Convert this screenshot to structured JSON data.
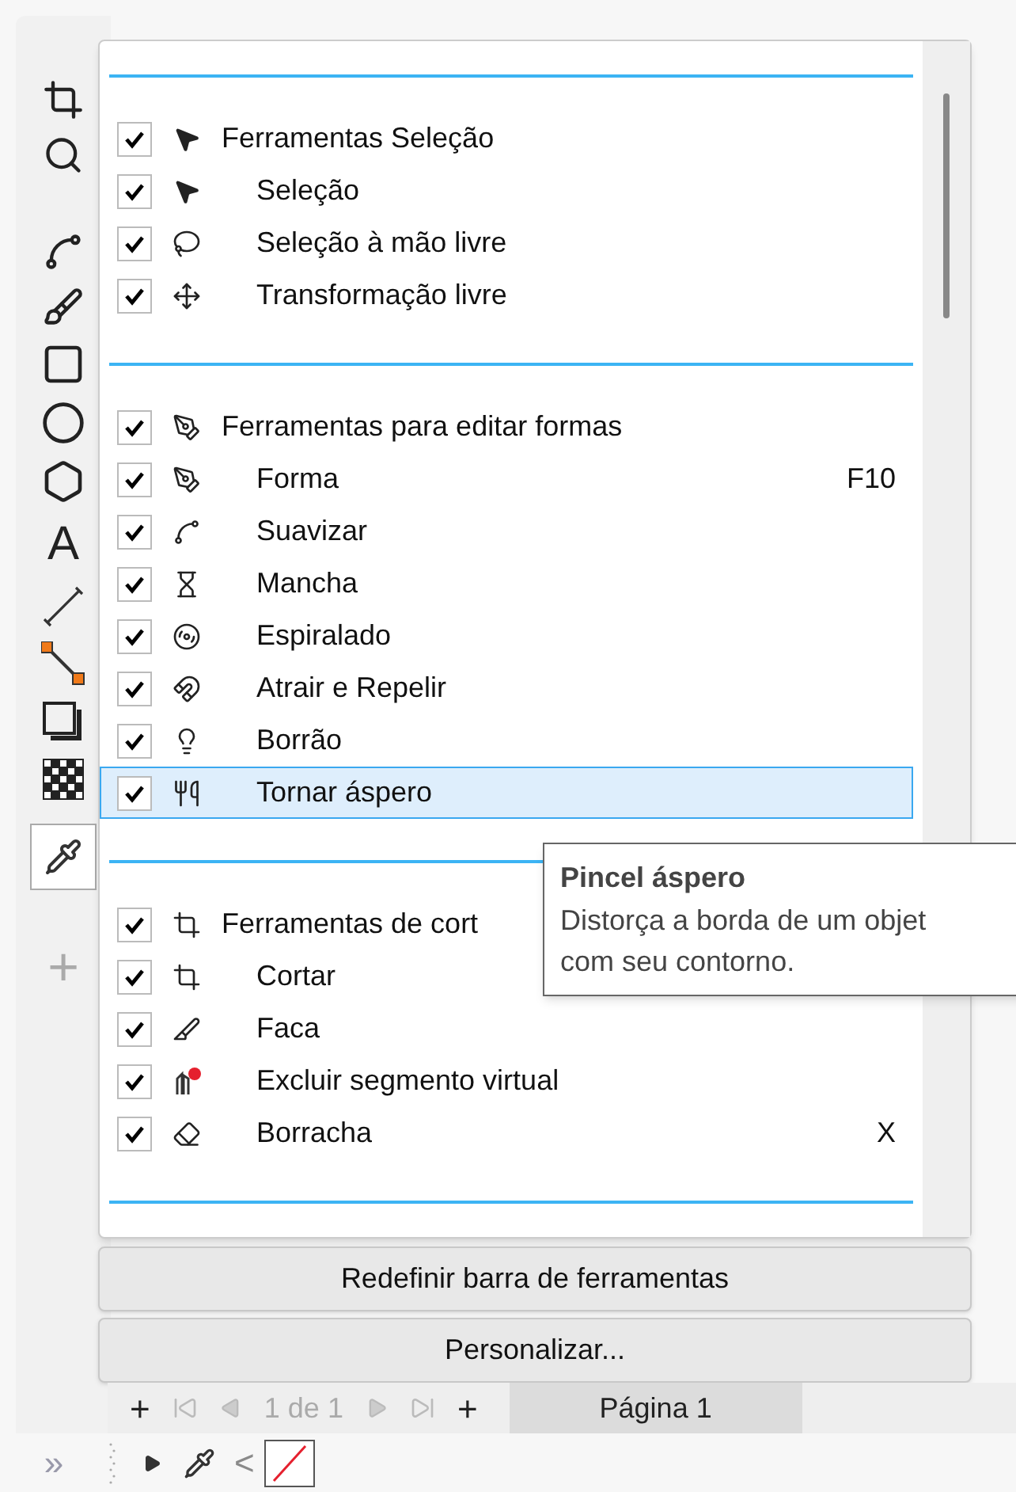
{
  "toolbox": {
    "text_tool": "A",
    "add_button": "+",
    "more_button": "»"
  },
  "menu": {
    "groups": [
      {
        "rows": [
          {
            "kind": "header",
            "label": "Ferramentas Seleção",
            "checked": true,
            "selected": false
          },
          {
            "kind": "tool",
            "label": "Seleção",
            "checked": true,
            "selected": false
          },
          {
            "kind": "tool",
            "label": "Seleção à mão livre",
            "checked": true,
            "selected": false
          },
          {
            "kind": "tool",
            "label": "Transformação livre",
            "checked": true,
            "selected": false
          }
        ]
      },
      {
        "rows": [
          {
            "kind": "header",
            "label": "Ferramentas para editar formas",
            "checked": true,
            "selected": false
          },
          {
            "kind": "tool",
            "label": "Forma",
            "shortcut": "F10",
            "checked": true,
            "selected": false
          },
          {
            "kind": "tool",
            "label": "Suavizar",
            "checked": true,
            "selected": false
          },
          {
            "kind": "tool",
            "label": "Mancha",
            "checked": true,
            "selected": false
          },
          {
            "kind": "tool",
            "label": "Espiralado",
            "checked": true,
            "selected": false
          },
          {
            "kind": "tool",
            "label": "Atrair e Repelir",
            "checked": true,
            "selected": false
          },
          {
            "kind": "tool",
            "label": "Borrão",
            "checked": true,
            "selected": false
          },
          {
            "kind": "tool",
            "label": "Tornar áspero",
            "checked": true,
            "selected": true
          }
        ]
      },
      {
        "rows": [
          {
            "kind": "header",
            "label": "Ferramentas de cort",
            "checked": true,
            "selected": false
          },
          {
            "kind": "tool",
            "label": "Cortar",
            "checked": true,
            "selected": false
          },
          {
            "kind": "tool",
            "label": "Faca",
            "checked": true,
            "selected": false
          },
          {
            "kind": "tool",
            "label": "Excluir segmento virtual",
            "checked": true,
            "selected": false
          },
          {
            "kind": "tool",
            "label": "Borracha",
            "shortcut": "X",
            "checked": true,
            "selected": false
          }
        ]
      }
    ],
    "buttons": [
      "Redefinir barra de ferramentas",
      "Personalizar..."
    ]
  },
  "tooltip": {
    "title": "Pincel áspero",
    "lines": [
      "Distorça a borda de um objet",
      "com seu contorno."
    ]
  },
  "page_bar": {
    "add_before": "+",
    "current": "1",
    "separator": "de",
    "total": "1",
    "add_after": "+",
    "tab": "Página 1"
  },
  "color_strip": {
    "back": "<"
  }
}
